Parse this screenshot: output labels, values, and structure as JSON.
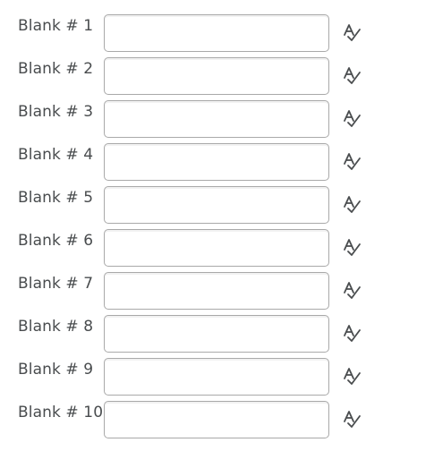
{
  "blanks": [
    {
      "label": "Blank # 1",
      "value": "",
      "spellcheck_icon": "spellcheck-icon"
    },
    {
      "label": "Blank # 2",
      "value": "",
      "spellcheck_icon": "spellcheck-icon"
    },
    {
      "label": "Blank # 3",
      "value": "",
      "spellcheck_icon": "spellcheck-icon"
    },
    {
      "label": "Blank # 4",
      "value": "",
      "spellcheck_icon": "spellcheck-icon"
    },
    {
      "label": "Blank # 5",
      "value": "",
      "spellcheck_icon": "spellcheck-icon"
    },
    {
      "label": "Blank # 6",
      "value": "",
      "spellcheck_icon": "spellcheck-icon"
    },
    {
      "label": "Blank # 7",
      "value": "",
      "spellcheck_icon": "spellcheck-icon"
    },
    {
      "label": "Blank # 8",
      "value": "",
      "spellcheck_icon": "spellcheck-icon"
    },
    {
      "label": "Blank # 9",
      "value": "",
      "spellcheck_icon": "spellcheck-icon"
    },
    {
      "label": "Blank # 10",
      "value": "",
      "spellcheck_icon": "spellcheck-icon"
    }
  ],
  "colors": {
    "label_text": "#494c4e",
    "input_border": "#a9a9a9",
    "icon": "#494c4e"
  }
}
